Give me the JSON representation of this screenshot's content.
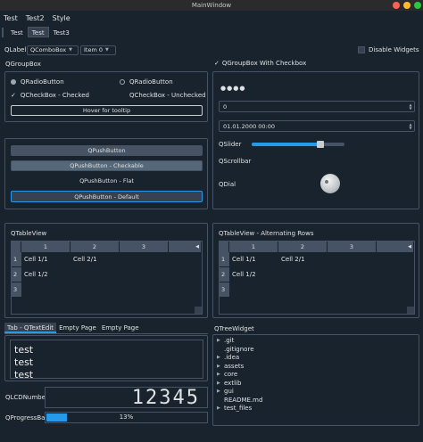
{
  "window": {
    "title": "MainWindow"
  },
  "colors": {
    "bg": "#19232d",
    "panel_border": "#455364",
    "accent": "#259ae9",
    "close": "#fe5f57",
    "minimize": "#febc2e",
    "maximize": "#28c840"
  },
  "menu": [
    "Test",
    "Test2",
    "Style"
  ],
  "toolbar": {
    "buttons": [
      "Test",
      "Test",
      "Test3"
    ]
  },
  "topbar": {
    "label": "QLabel",
    "combo1": "QComboBox",
    "combo2": "Item 0",
    "disable_label": "Disable Widgets"
  },
  "groupbox1": {
    "title": "QGroupBox",
    "radio1": "QRadioButton",
    "radio2": "QRadioButton",
    "check1": "QCheckBox - Checked",
    "check2": "QCheckBox - Unchecked",
    "hover": "Hover for tooltip"
  },
  "groupbox2": {
    "title": "QGroupBox With Checkbox",
    "password": "●●●●",
    "spin_value": "0",
    "datetime": "01.01.2000 00:00",
    "slider_label": "QSlider",
    "slider_value": 0.74,
    "scrollbar_label": "QScrollbar",
    "dial_label": "QDial"
  },
  "buttons": {
    "push": "QPushButton",
    "checkable": "QPushButton - Checkable",
    "flat": "QPushButton - Flat",
    "default": "QPushButton - Default"
  },
  "table1": {
    "title": "QTableView",
    "columns": [
      "1",
      "2",
      "3"
    ],
    "rows": [
      "1",
      "2",
      "3"
    ],
    "cells": [
      [
        "Cell 1/1",
        "Cell 2/1"
      ],
      [
        "Cell 1/2",
        ""
      ]
    ]
  },
  "table2": {
    "title": "QTableView - Alternating Rows",
    "columns": [
      "1",
      "2",
      "3"
    ],
    "rows": [
      "1",
      "2",
      "3"
    ],
    "cells": [
      [
        "Cell 1/1",
        "Cell 2/1"
      ],
      [
        "Cell 1/2",
        ""
      ]
    ]
  },
  "tabs": {
    "labels": [
      "Tab - QTextEdit",
      "Empty Page",
      "Empty Page"
    ],
    "text_lines": [
      "test",
      "test",
      "test"
    ]
  },
  "lcd": {
    "label": "QLCDNumber",
    "value": "12345"
  },
  "progress": {
    "label": "QProgressBar",
    "value": 0.13,
    "text": "13%"
  },
  "tree": {
    "title": "QTreeWidget",
    "items": [
      {
        "name": ".git",
        "expandable": true
      },
      {
        "name": ".gitignore",
        "expandable": false
      },
      {
        "name": ".idea",
        "expandable": true
      },
      {
        "name": "assets",
        "expandable": true
      },
      {
        "name": "core",
        "expandable": true
      },
      {
        "name": "extlib",
        "expandable": true
      },
      {
        "name": "gui",
        "expandable": true
      },
      {
        "name": "README.md",
        "expandable": false
      },
      {
        "name": "test_files",
        "expandable": true
      }
    ]
  }
}
